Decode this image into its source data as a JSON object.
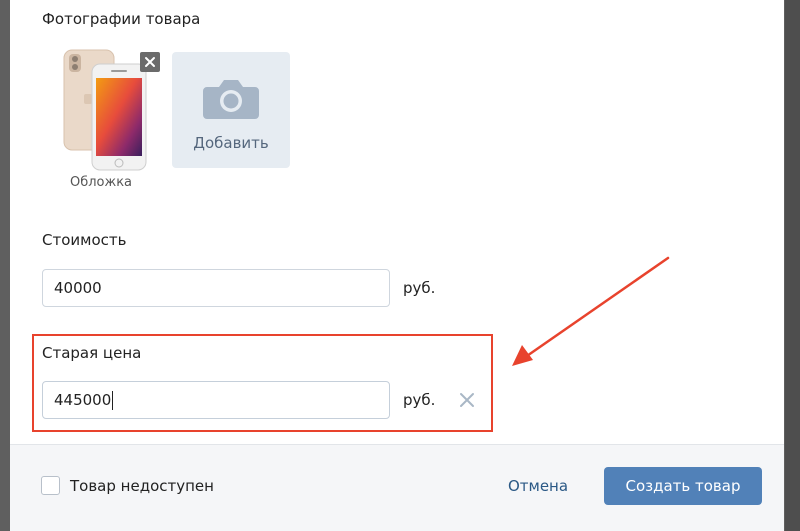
{
  "photos": {
    "title": "Фотографии товара",
    "cover_caption": "Обложка",
    "add_label": "Добавить",
    "cover_icon": "iphone-photo",
    "remove_icon": "close-icon",
    "add_icon": "camera-icon"
  },
  "price": {
    "label": "Стоимость",
    "value": "40000",
    "unit": "руб."
  },
  "old_price": {
    "label": "Старая цена",
    "value": "445000",
    "unit": "руб.",
    "clear_icon": "clear-icon"
  },
  "footer": {
    "unavailable_label": "Товар недоступен",
    "unavailable_checked": false,
    "cancel_label": "Отмена",
    "create_label": "Создать товар"
  },
  "colors": {
    "annotation": "#e8432d",
    "primary_button": "#5181b8",
    "link": "#2a5885"
  }
}
